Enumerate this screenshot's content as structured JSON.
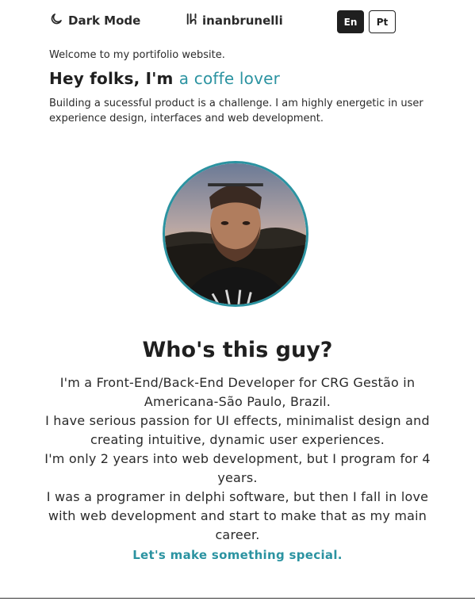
{
  "header": {
    "dark_mode_label": "Dark Mode",
    "logo_text": "inanbrunelli",
    "languages": [
      {
        "label": "En",
        "active": true
      },
      {
        "label": "Pt",
        "active": false
      }
    ]
  },
  "intro": {
    "welcome": "Welcome to my portifolio website.",
    "headline_prefix": "Hey folks, I'm ",
    "headline_accent": "a coffe lover",
    "tagline": "Building a sucessful product is a challenge. I am highly energetic in user experience design, interfaces and web development."
  },
  "about": {
    "title": "Who's this guy?",
    "paragraphs": [
      "I'm a Front-End/Back-End Developer for CRG Gestão in Americana-São Paulo, Brazil.",
      "I have serious passion for UI effects, minimalist design and creating intuitive, dynamic user experiences.",
      "I'm only 2 years into web development, but I program for 4 years.",
      "I was a programer in delphi software, but then I fall in love with web development and start to make that as my main career."
    ],
    "cta": "Let's make something special."
  },
  "colors": {
    "accent": "#2b93a1",
    "text": "#1f1f1f",
    "background": "#ffffff"
  }
}
